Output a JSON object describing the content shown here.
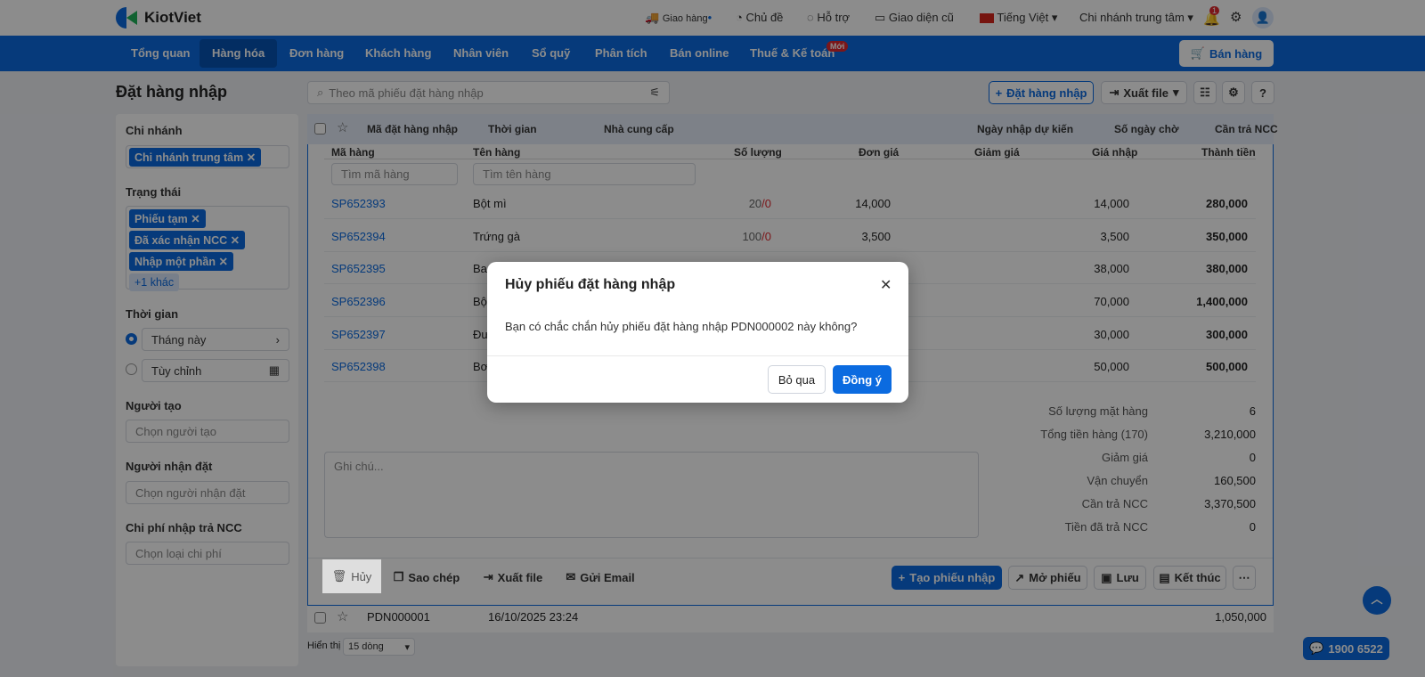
{
  "header": {
    "logo": "KiotViet",
    "items": [
      {
        "label": "Giao hàng",
        "icon": "delivery-icon"
      },
      {
        "label": "Chủ đề",
        "icon": "palette-icon"
      },
      {
        "label": "Hỗ trợ",
        "icon": "support-icon"
      },
      {
        "label": "Giao diện cũ",
        "icon": "monitor-icon"
      },
      {
        "label": "Tiếng Việt",
        "icon": "vn-flag-icon"
      },
      {
        "label": "Chi nhánh trung tâm"
      }
    ],
    "notification_count": "1"
  },
  "nav": {
    "items": [
      "Tổng quan",
      "Hàng hóa",
      "Đơn hàng",
      "Khách hàng",
      "Nhân viên",
      "Sổ quỹ",
      "Phân tích",
      "Bán online",
      "Thuế & Kế toán"
    ],
    "active": "Hàng hóa",
    "new_badge": "Mới",
    "sell_button": "Bán hàng",
    "accent": "#0b6be0"
  },
  "page": {
    "title": "Đặt hàng nhập",
    "search_placeholder": "Theo mã phiếu đặt hàng nhập",
    "add_button": "Đặt hàng nhập",
    "export_button": "Xuất file"
  },
  "filters": {
    "branch_label": "Chi nhánh",
    "branch_tags": [
      "Chi nhánh trung tâm"
    ],
    "status_label": "Trạng thái",
    "status_tags": [
      "Phiếu tạm",
      "Đã xác nhận NCC",
      "Nhập một phần"
    ],
    "status_more": "+1 khác",
    "time_label": "Thời gian",
    "time_options": [
      "Tháng này",
      "Tùy chỉnh"
    ],
    "creator_label": "Người tạo",
    "creator_placeholder": "Chọn người tạo",
    "receiver_label": "Người nhận đặt",
    "receiver_placeholder": "Chọn người nhận đặt",
    "cost_label": "Chi phí nhập trả NCC",
    "cost_placeholder": "Chọn loại chi phí"
  },
  "table": {
    "columns": [
      "Mã đặt hàng nhập",
      "Thời gian",
      "Nhà cung cấp",
      "Ngày nhập dự kiến",
      "Số ngày chờ",
      "Cần trả NCC"
    ],
    "detail_columns": [
      "Mã hàng",
      "Tên hàng",
      "Số lượng",
      "Đơn giá",
      "Giảm giá",
      "Giá nhập",
      "Thành tiền"
    ],
    "code_filter_placeholder": "Tìm mã hàng",
    "name_filter_placeholder": "Tìm tên hàng",
    "items": [
      {
        "code": "SP652393",
        "name": "Bột mì",
        "qty": "20",
        "recv": "/0",
        "price": "14,000",
        "cost": "14,000",
        "total": "280,000"
      },
      {
        "code": "SP652394",
        "name": "Trứng gà",
        "qty": "100",
        "recv": "/0",
        "price": "3,500",
        "cost": "3,500",
        "total": "350,000"
      },
      {
        "code": "SP652395",
        "name": "Ba",
        "qty": "",
        "recv": "",
        "price": "",
        "cost": "38,000",
        "total": "380,000"
      },
      {
        "code": "SP652396",
        "name": "Bộ",
        "qty": "",
        "recv": "",
        "price": "",
        "cost": "70,000",
        "total": "1,400,000"
      },
      {
        "code": "SP652397",
        "name": "Đư",
        "qty": "",
        "recv": "",
        "price": "",
        "cost": "30,000",
        "total": "300,000"
      },
      {
        "code": "SP652398",
        "name": "Bơ",
        "qty": "",
        "recv": "",
        "price": "",
        "cost": "50,000",
        "total": "500,000"
      }
    ],
    "note_placeholder": "Ghi chú...",
    "summary": [
      {
        "label": "Số lượng mặt hàng",
        "value": "6"
      },
      {
        "label": "Tổng tiền hàng (170)",
        "value": "3,210,000"
      },
      {
        "label": "Giảm giá",
        "value": "0"
      },
      {
        "label": "Vận chuyển",
        "value": "160,500"
      },
      {
        "label": "Cần trả NCC",
        "value": "3,370,500"
      },
      {
        "label": "Tiền đã trả NCC",
        "value": "0"
      }
    ],
    "actions_left": [
      "Hủy",
      "Sao chép",
      "Xuất file",
      "Gửi Email"
    ],
    "actions_right": [
      "Tạo phiếu nhập",
      "Mở phiếu",
      "Lưu",
      "Kết thúc"
    ],
    "other_row": {
      "code": "PDN000001",
      "time": "16/10/2025 23:24",
      "total": "1,050,000"
    },
    "page_size_label": "Hiển thị",
    "page_size": "15 dòng"
  },
  "dialog": {
    "title": "Hủy phiếu đặt hàng nhập",
    "message": "Bạn có chắc chắn hủy phiếu đặt hàng nhập PDN000002 này không?",
    "cancel": "Bỏ qua",
    "confirm": "Đồng ý"
  },
  "hotline": "1900 6522"
}
